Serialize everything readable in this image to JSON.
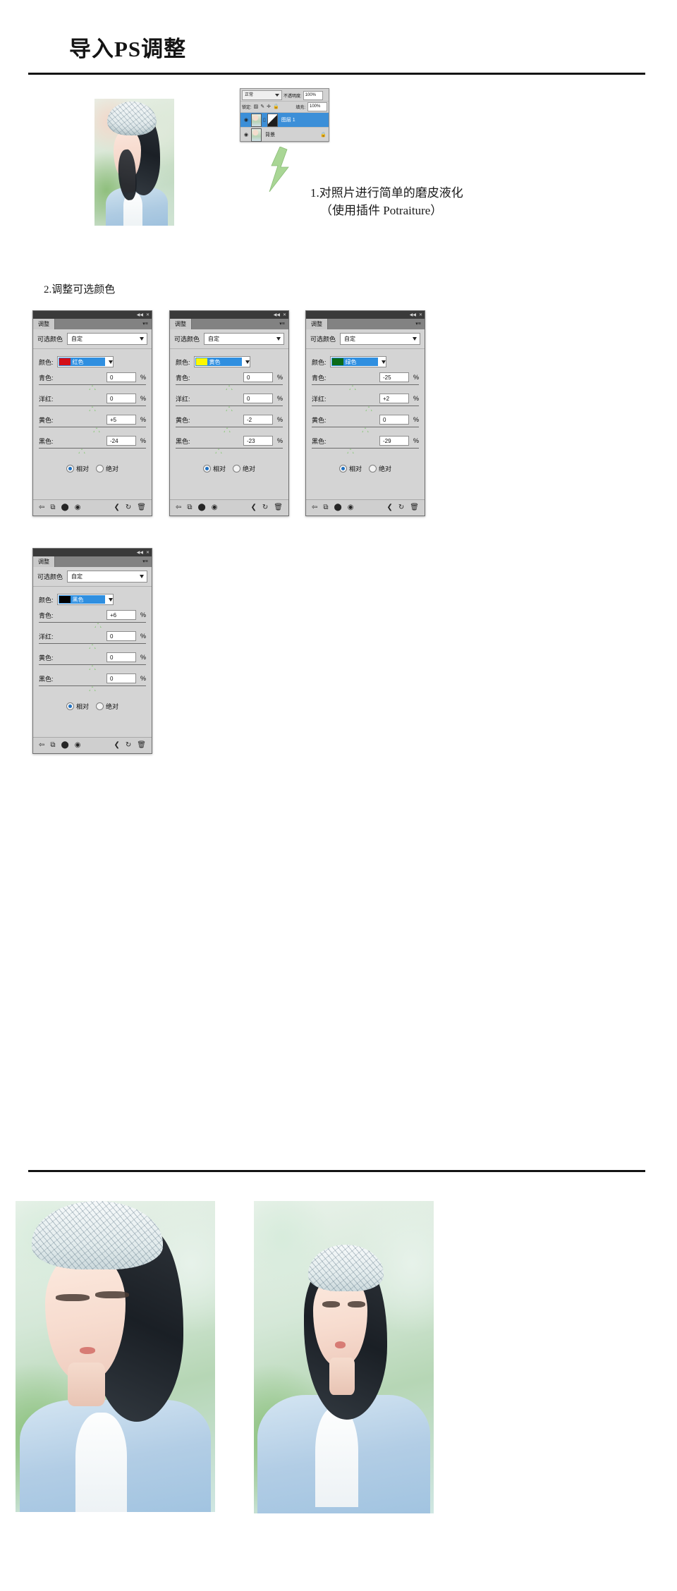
{
  "header": {
    "title": "导入PS调整"
  },
  "step1": {
    "caption_line1": "1.对照片进行简单的磨皮液化",
    "caption_line2": "（使用插件 Potraiture）"
  },
  "step2": {
    "caption": "2.调整可选颜色"
  },
  "layers_panel": {
    "blend_mode": "正常",
    "opacity_label": "不透明度:",
    "opacity_value": "100%",
    "lock_label": "锁定:",
    "fill_label": "填充:",
    "fill_value": "100%",
    "lock_icons": [
      "transparency-lock-icon",
      "brush-lock-icon",
      "move-lock-icon",
      "lock-all-icon"
    ],
    "layers": [
      {
        "name": "图层 1",
        "selected": true,
        "eye": "eye-icon",
        "has_mask": true,
        "link": "link-icon",
        "locked": false
      },
      {
        "name": "背景",
        "selected": false,
        "eye": "eye-icon",
        "has_mask": false,
        "link": "",
        "locked": true
      }
    ]
  },
  "panel_common": {
    "tab_label": "调整",
    "preset_label": "可选颜色",
    "preset_value": "自定",
    "color_label": "颜色:",
    "percent": "%",
    "slider_labels": [
      "青色:",
      "洋红:",
      "黄色:",
      "黑色:"
    ],
    "mode_relative": "相对",
    "mode_absolute": "绝对",
    "selected_mode": "相对",
    "footer_icons": [
      "return-icon",
      "clip-to-layer-icon",
      "mask-icon",
      "eye-toggle-icon",
      "previous-state-icon",
      "reset-icon",
      "delete-icon"
    ],
    "titlebar_icons": [
      "collapse-icon",
      "close-icon"
    ],
    "menu_icon": "panel-menu-icon"
  },
  "panels": [
    {
      "id": "panel-1",
      "color_name": "红色",
      "swatch_hex": "#d40f18",
      "values": [
        "0",
        "0",
        "+5",
        "-24"
      ],
      "knob_pct": [
        50,
        50,
        54,
        40
      ]
    },
    {
      "id": "panel-2",
      "color_name": "黄色",
      "swatch_hex": "#fdf800",
      "values": [
        "0",
        "0",
        "-2",
        "-23"
      ],
      "knob_pct": [
        50,
        50,
        48,
        40
      ]
    },
    {
      "id": "panel-3",
      "color_name": "绿色",
      "swatch_hex": "#0b6b18",
      "values": [
        "-25",
        "+2",
        "0",
        "-29"
      ],
      "knob_pct": [
        38,
        53,
        50,
        36
      ]
    },
    {
      "id": "panel-4",
      "color_name": "黑色",
      "swatch_hex": "#000000",
      "values": [
        "+6",
        "0",
        "0",
        "0"
      ],
      "knob_pct": [
        55,
        50,
        50,
        50
      ]
    }
  ],
  "colors": {
    "accent_blue": "#2f8fe0",
    "panel_grey": "#d4d4d4",
    "slider_green": "#9ccb8f",
    "bolt_green": "#a9d695",
    "rule_black": "#141414"
  },
  "results": {
    "left_photo_alt": "retouched-portrait-closeup",
    "right_photo_alt": "retouched-portrait-full"
  }
}
